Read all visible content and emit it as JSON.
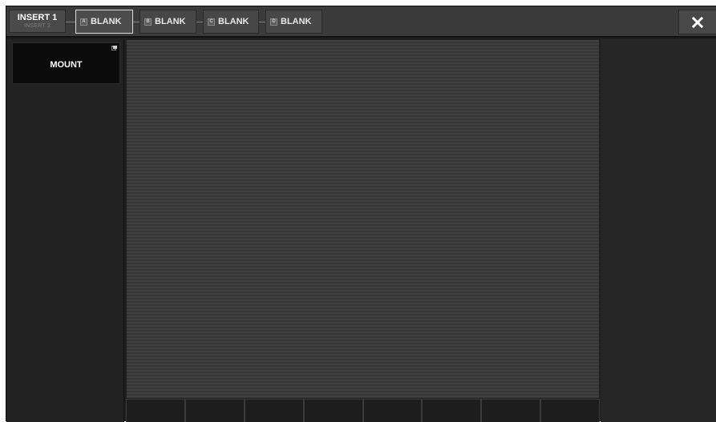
{
  "header": {
    "insert_tab": {
      "label": "INSERT 1",
      "sublabel": "INSERT 2"
    },
    "slots": [
      {
        "letter": "A",
        "label": "BLANK",
        "selected": true
      },
      {
        "letter": "B",
        "label": "BLANK",
        "selected": false
      },
      {
        "letter": "C",
        "label": "BLANK",
        "selected": false
      },
      {
        "letter": "D",
        "label": "BLANK",
        "selected": false
      }
    ],
    "close_icon": "close-icon"
  },
  "left_panel": {
    "mount_label": "MOUNT",
    "mount_icon": "popup-icon"
  },
  "center_panel": {},
  "knob_row": {
    "count": 8
  },
  "colors": {
    "background": "#1e1e1e",
    "topbar": "#3a3a3a",
    "selected_border": "#d9d9d9",
    "mount_button": "#0b0b0b"
  }
}
